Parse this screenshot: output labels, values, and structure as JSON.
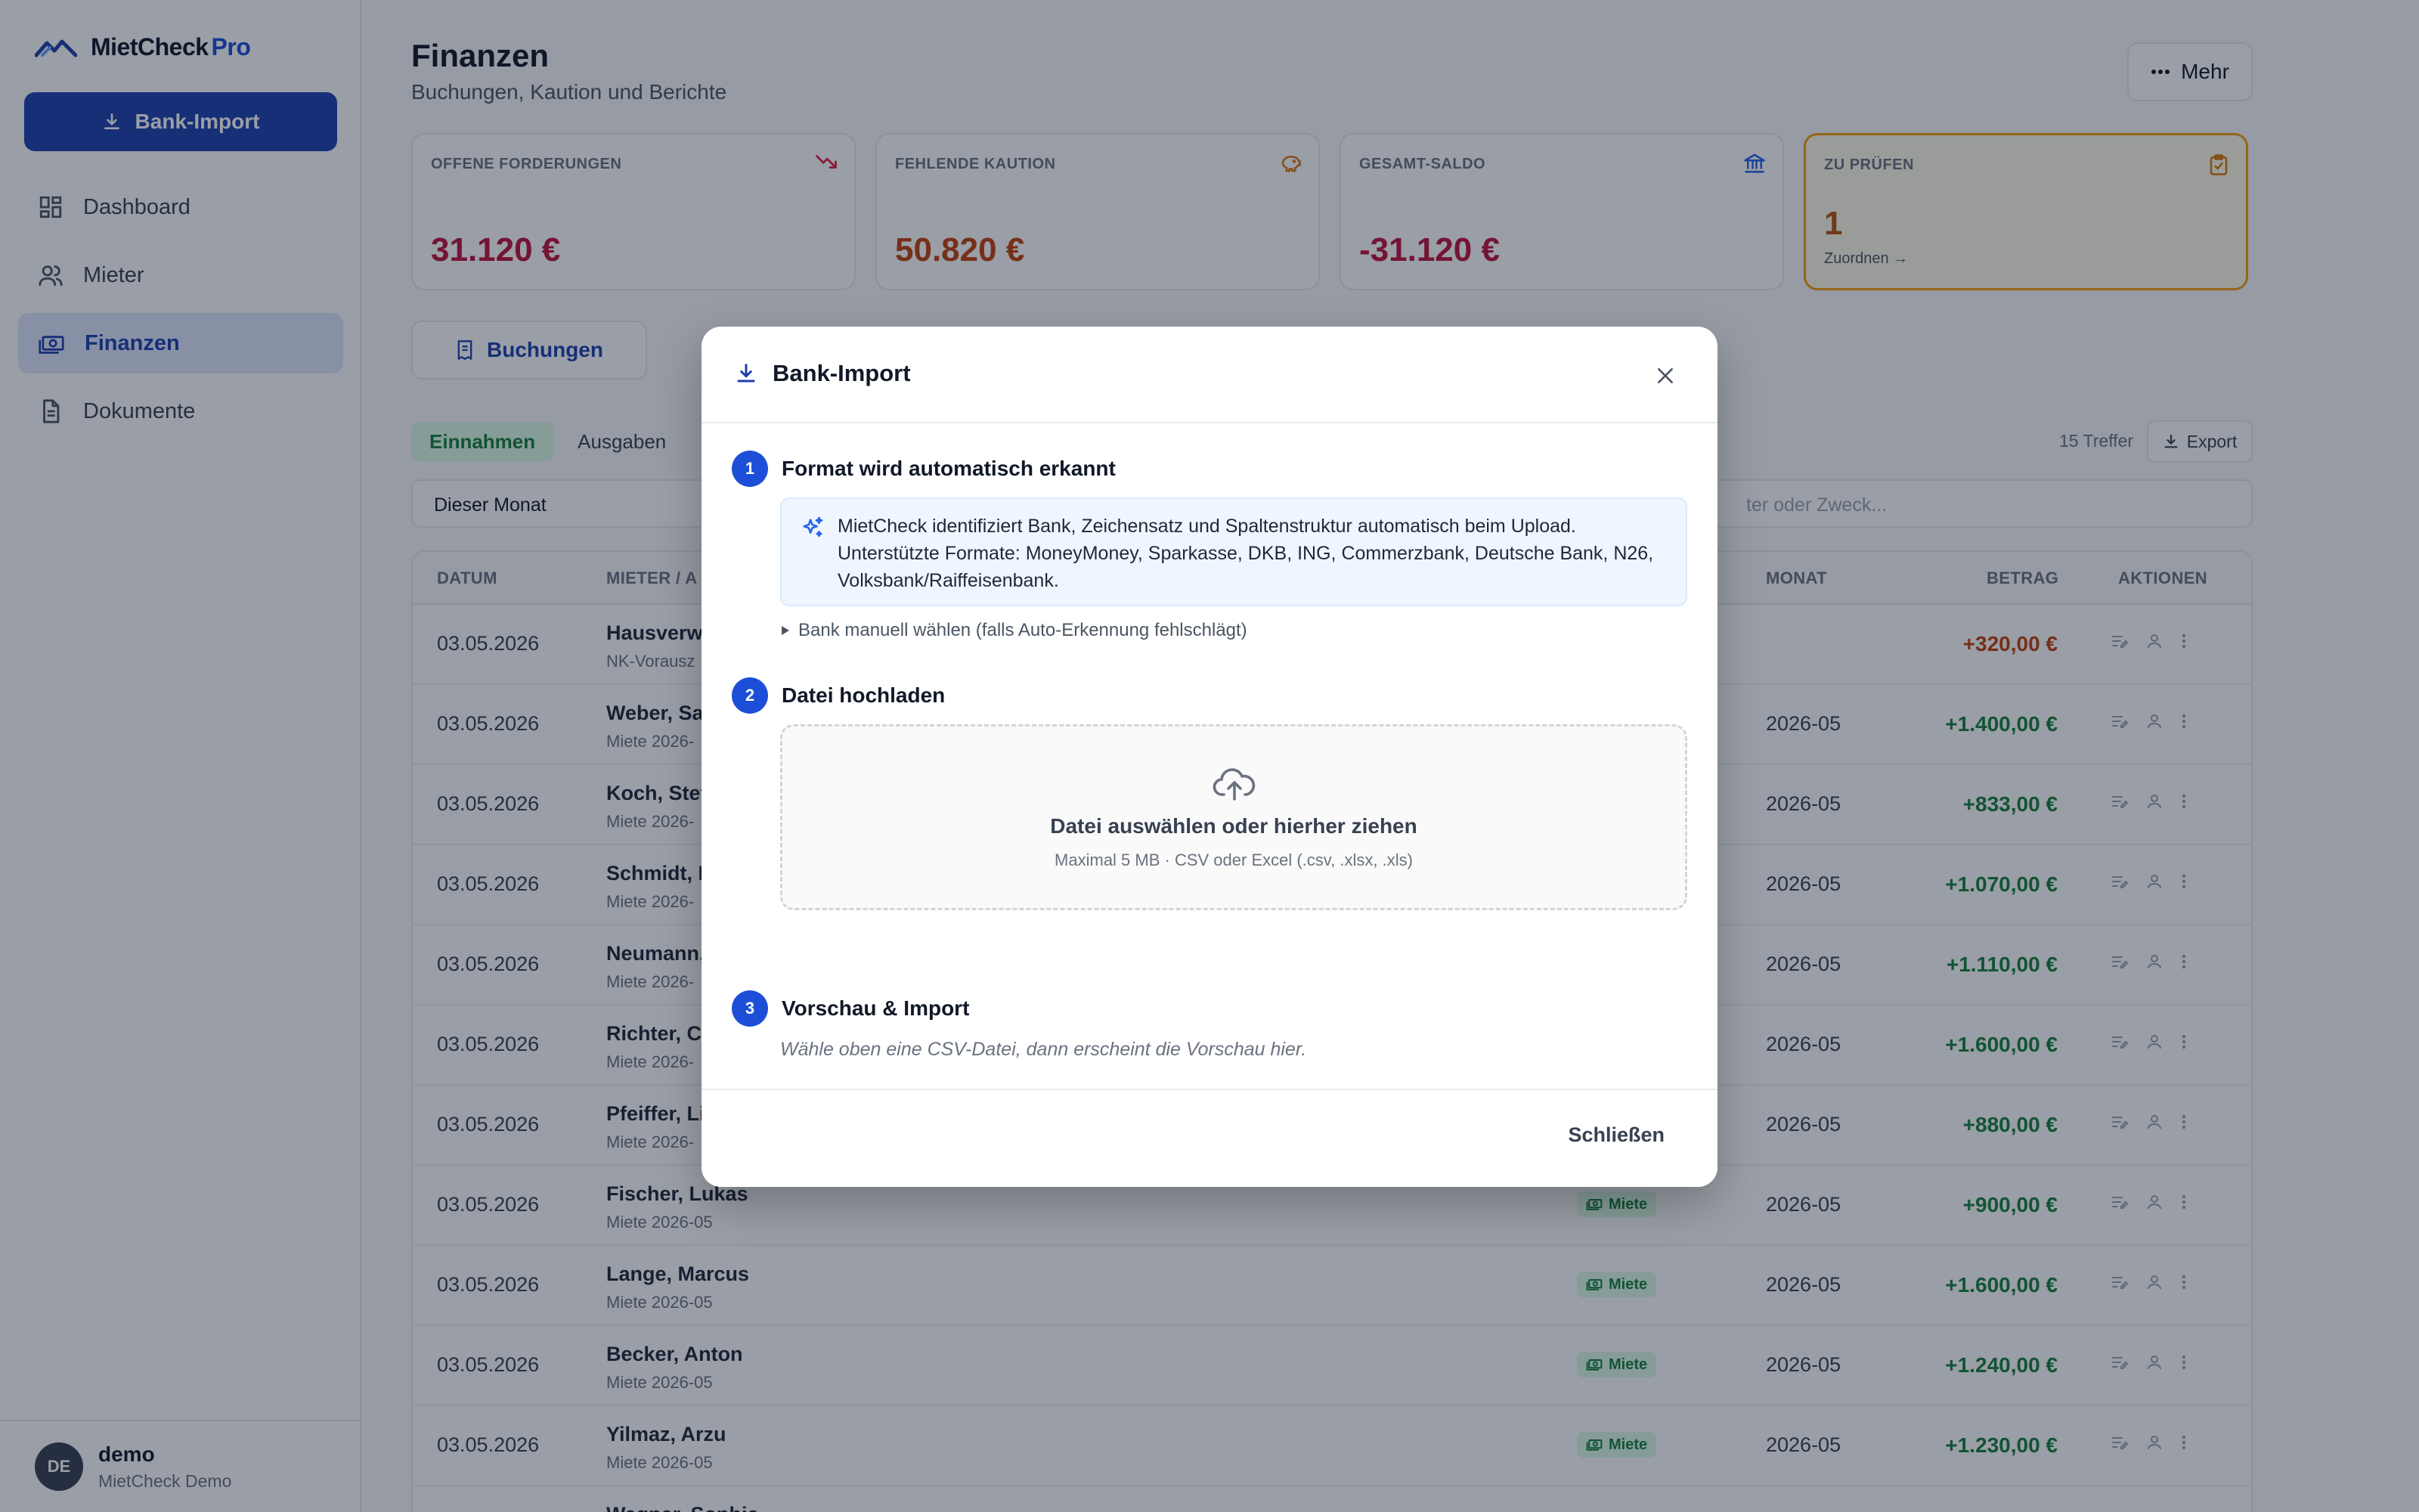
{
  "sidebar": {
    "brand": "MietCheck",
    "brand_suffix": "Pro",
    "import_button": "Bank-Import",
    "nav": [
      {
        "label": "Dashboard",
        "icon": "dashboard-icon"
      },
      {
        "label": "Mieter",
        "icon": "users-icon"
      },
      {
        "label": "Finanzen",
        "icon": "money-icon",
        "active": true
      },
      {
        "label": "Dokumente",
        "icon": "document-icon"
      }
    ],
    "user": {
      "initials": "DE",
      "name": "demo",
      "subtitle": "MietCheck Demo"
    }
  },
  "header": {
    "title": "Finanzen",
    "subtitle": "Buchungen, Kaution und Berichte",
    "more_button": "Mehr"
  },
  "cards": [
    {
      "label": "OFFENE FORDERUNGEN",
      "value": "31.120 €",
      "color": "#be123c",
      "icon": "trend-down-icon"
    },
    {
      "label": "FEHLENDE KAUTION",
      "value": "50.820 €",
      "color": "#c2410c",
      "icon": "piggy-bank-icon"
    },
    {
      "label": "GESAMT-SALDO",
      "value": "-31.120 €",
      "color": "#be123c",
      "icon": "bank-icon"
    },
    {
      "label": "ZU PRÜFEN",
      "value": "1",
      "color": "#b45309",
      "icon": "clipboard-icon",
      "link": "Zuordnen →"
    }
  ],
  "tabs": {
    "bookings": "Buchungen"
  },
  "subtabs": {
    "income": "Einnahmen",
    "expenses": "Ausgaben",
    "partial": "A"
  },
  "toolbar": {
    "hits": "15 Treffer",
    "export": "Export"
  },
  "filter": {
    "period": "Dieser Monat",
    "search_placeholder": "ter oder Zweck..."
  },
  "table": {
    "headers": {
      "date": "DATUM",
      "tenant": "MIETER / A",
      "month": "MONAT",
      "amount": "BETRAG",
      "actions": "AKTIONEN"
    },
    "rows": [
      {
        "date": "03.05.2026",
        "name": "Hausverw",
        "sub": "NK-Vorausz",
        "badge": "",
        "month": "",
        "amount": "+320,00 €",
        "amount_color": "#c2410c"
      },
      {
        "date": "03.05.2026",
        "name": "Weber, Sa",
        "sub": "Miete 2026-",
        "badge": "",
        "month": "2026-05",
        "amount": "+1.400,00 €",
        "amount_color": "#15803d"
      },
      {
        "date": "03.05.2026",
        "name": "Koch, Stef",
        "sub": "Miete 2026-",
        "badge": "",
        "month": "2026-05",
        "amount": "+833,00 €",
        "amount_color": "#15803d"
      },
      {
        "date": "03.05.2026",
        "name": "Schmidt, N",
        "sub": "Miete 2026-",
        "badge": "",
        "month": "2026-05",
        "amount": "+1.070,00 €",
        "amount_color": "#15803d"
      },
      {
        "date": "03.05.2026",
        "name": "Neumann,",
        "sub": "Miete 2026-",
        "badge": "",
        "month": "2026-05",
        "amount": "+1.110,00 €",
        "amount_color": "#15803d"
      },
      {
        "date": "03.05.2026",
        "name": "Richter, Ca",
        "sub": "Miete 2026-",
        "badge": "",
        "month": "2026-05",
        "amount": "+1.600,00 €",
        "amount_color": "#15803d"
      },
      {
        "date": "03.05.2026",
        "name": "Pfeiffer, Li",
        "sub": "Miete 2026-",
        "badge": "",
        "month": "2026-05",
        "amount": "+880,00 €",
        "amount_color": "#15803d"
      },
      {
        "date": "03.05.2026",
        "name": "Fischer, Lukas",
        "sub": "Miete 2026-05",
        "badge": "Miete",
        "month": "2026-05",
        "amount": "+900,00 €",
        "amount_color": "#15803d"
      },
      {
        "date": "03.05.2026",
        "name": "Lange, Marcus",
        "sub": "Miete 2026-05",
        "badge": "Miete",
        "month": "2026-05",
        "amount": "+1.600,00 €",
        "amount_color": "#15803d"
      },
      {
        "date": "03.05.2026",
        "name": "Becker, Anton",
        "sub": "Miete 2026-05",
        "badge": "Miete",
        "month": "2026-05",
        "amount": "+1.240,00 €",
        "amount_color": "#15803d"
      },
      {
        "date": "03.05.2026",
        "name": "Yilmaz, Arzu",
        "sub": "Miete 2026-05",
        "badge": "Miete",
        "month": "2026-05",
        "amount": "+1.230,00 €",
        "amount_color": "#15803d"
      },
      {
        "date": "",
        "name": "Wagner, Sophie",
        "sub": "",
        "badge": "",
        "month": "",
        "amount": "",
        "amount_color": "#15803d"
      }
    ]
  },
  "modal": {
    "title": "Bank-Import",
    "step1": {
      "num": "1",
      "title": "Format wird automatisch erkannt",
      "info_line1": "MietCheck identifiziert Bank, Zeichensatz und Spaltenstruktur automatisch beim Upload.",
      "info_line2": "Unterstützte Formate: MoneyMoney, Sparkasse, DKB, ING, Commerzbank, Deutsche Bank, N26,",
      "info_line3": "Volksbank/Raiffeisenbank.",
      "manual": "Bank manuell wählen (falls Auto-Erkennung fehlschlägt)"
    },
    "step2": {
      "num": "2",
      "title": "Datei hochladen",
      "drop_main": "Datei auswählen oder hierher ziehen",
      "drop_sub": "Maximal 5 MB · CSV oder Excel (.csv, .xlsx, .xls)"
    },
    "step3": {
      "num": "3",
      "title": "Vorschau & Import",
      "hint": "Wähle oben eine CSV-Datei, dann erscheint die Vorschau hier."
    },
    "close_button": "Schließen"
  }
}
